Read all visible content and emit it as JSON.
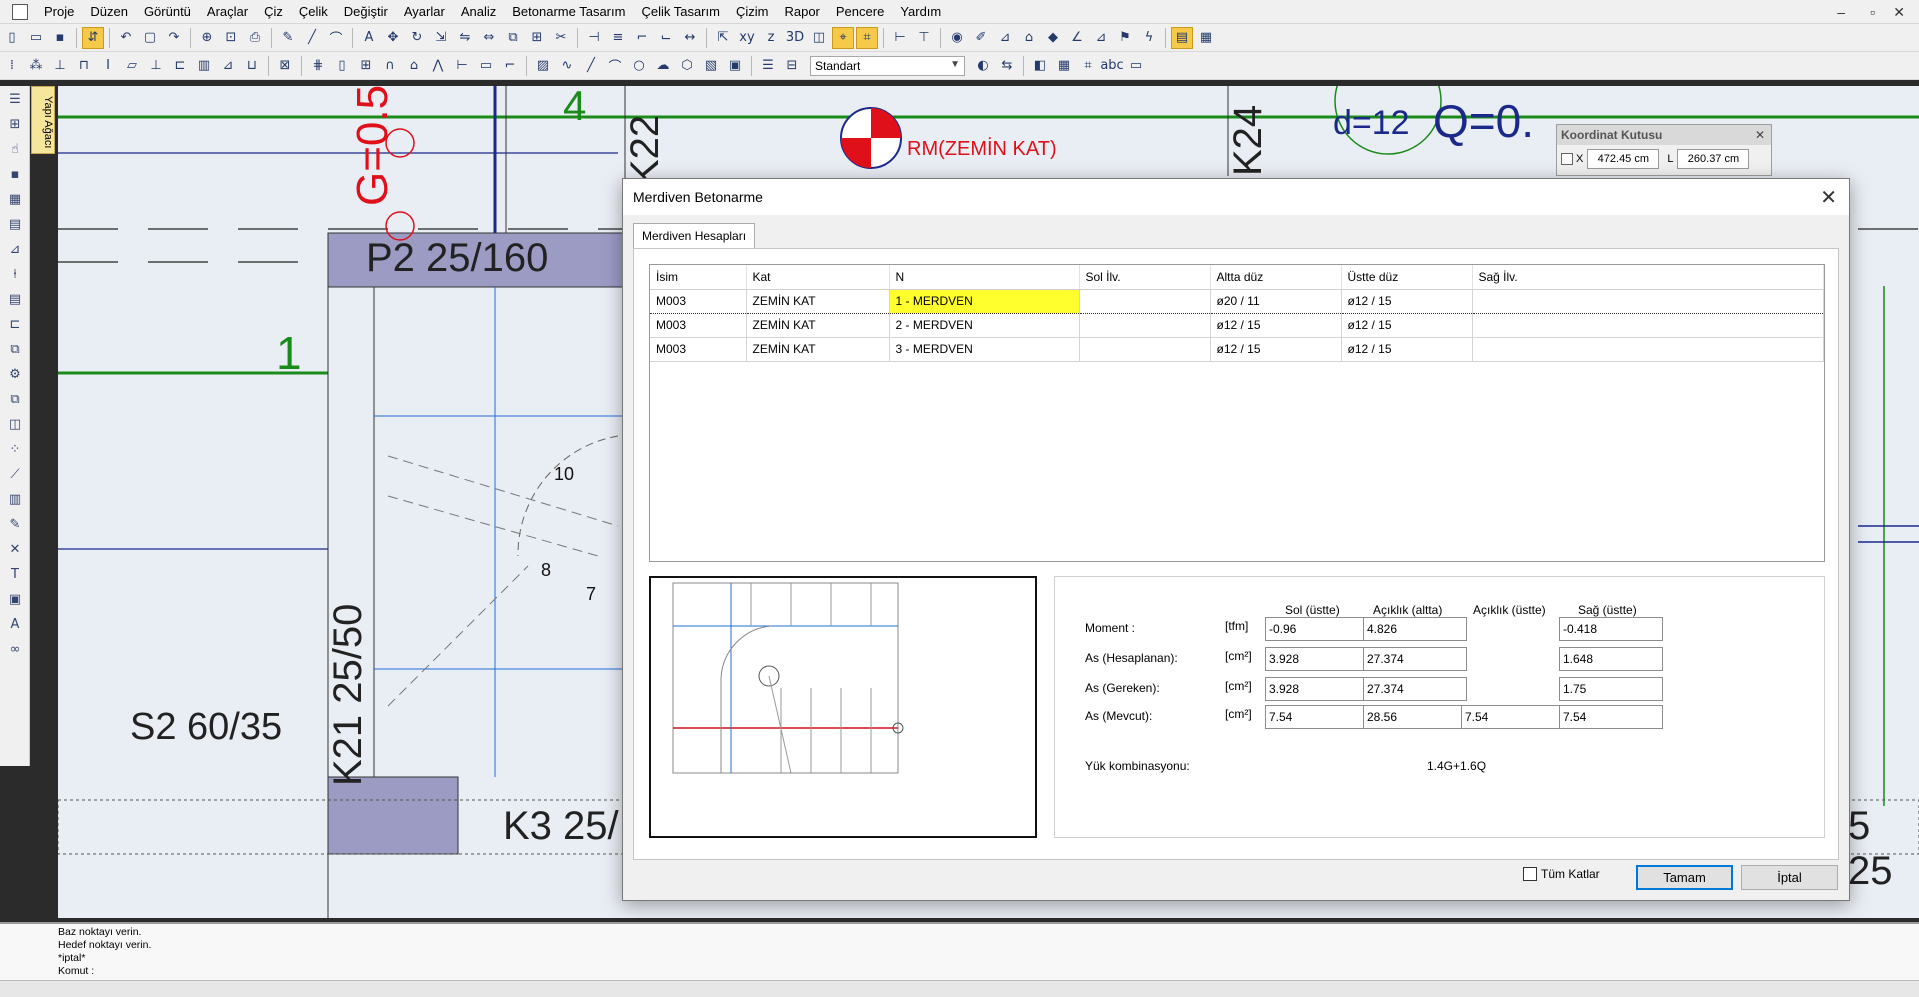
{
  "menu": [
    "Proje",
    "Düzen",
    "Görüntü",
    "Araçlar",
    "Çiz",
    "Çelik",
    "Değiştir",
    "Ayarlar",
    "Analiz",
    "Betonarme Tasarım",
    "Çelik Tasarım",
    "Çizim",
    "Rapor",
    "Pencere",
    "Yardım"
  ],
  "window_controls": {
    "minimize": "–",
    "restore": "▫",
    "close": "✕"
  },
  "toolbar": {
    "style_select": "Standart"
  },
  "tree_tab": "Yapı Ağacı",
  "canvas_labels": {
    "g_label": "G=0.5",
    "axis_4": "4",
    "axis_1": "1",
    "column_k22": "K22",
    "column_k24": "K24",
    "rm_label": "RM(ZEMİN KAT)",
    "d_label": "d=12",
    "p2_label": "P2 25/160",
    "k21_label": "K21 25/50",
    "s2_label": "S2 60/35",
    "k3_label": "K3 25/",
    "q_label": "Q=0.",
    "step_10": "10",
    "step_8": "8",
    "step_7": "7",
    "right_5": "5 25"
  },
  "coord_box": {
    "title": "Koordinat Kutusu",
    "x_label": "X",
    "x_value": "472.45 cm",
    "l_label": "L",
    "l_value": "260.37 cm"
  },
  "dialog": {
    "title": "Merdiven Betonarme",
    "tab": "Merdiven Hesapları",
    "columns": [
      "İsim",
      "Kat",
      "N",
      "Sol İlv.",
      "Altta düz",
      "Üstte düz",
      "Sağ İlv."
    ],
    "rows": [
      [
        "M003",
        "ZEMİN KAT",
        "1 - MERDVEN",
        "",
        "ø20 / 11",
        "ø12 / 15",
        ""
      ],
      [
        "M003",
        "ZEMİN KAT",
        "2 - MERDVEN",
        "",
        "ø12 / 15",
        "ø12 / 15",
        ""
      ],
      [
        "M003",
        "ZEMİN KAT",
        "3 - MERDVEN",
        "",
        "ø12 / 15",
        "ø12 / 15",
        ""
      ]
    ],
    "selected_row": 0,
    "results": {
      "headers": [
        "Sol (üstte)",
        "Açıklık (altta)",
        "Açıklık (üstte)",
        "Sağ (üstte)"
      ],
      "rows": [
        {
          "label": "Moment :",
          "unit": "[tfm]",
          "values": [
            "-0.96",
            "4.826",
            null,
            "-0.418"
          ]
        },
        {
          "label": "As (Hesaplanan):",
          "unit": "[cm²]",
          "values": [
            "3.928",
            "27.374",
            null,
            "1.648"
          ]
        },
        {
          "label": "As (Gereken):",
          "unit": "[cm²]",
          "values": [
            "3.928",
            "27.374",
            null,
            "1.75"
          ]
        },
        {
          "label": "As (Mevcut):",
          "unit": "[cm²]",
          "values": [
            "7.54",
            "28.56",
            "7.54",
            "7.54"
          ]
        }
      ],
      "load_combo_label": "Yük kombinasyonu:",
      "load_combo_value": "1.4G+1.6Q"
    },
    "all_floors_label": "Tüm Katlar",
    "ok_label": "Tamam",
    "cancel_label": "İptal"
  },
  "command_lines": [
    "Baz noktayı verin.",
    "Hedef noktayı verin.",
    "*iptal*",
    "Komut :"
  ],
  "colors": {
    "canvas_bg": "#e9edf4",
    "axis_green": "#1a8a1a",
    "red": "#e0101a",
    "navy": "#1b2a8a",
    "highlight": "#ffff2e",
    "accent": "#0078d7"
  }
}
